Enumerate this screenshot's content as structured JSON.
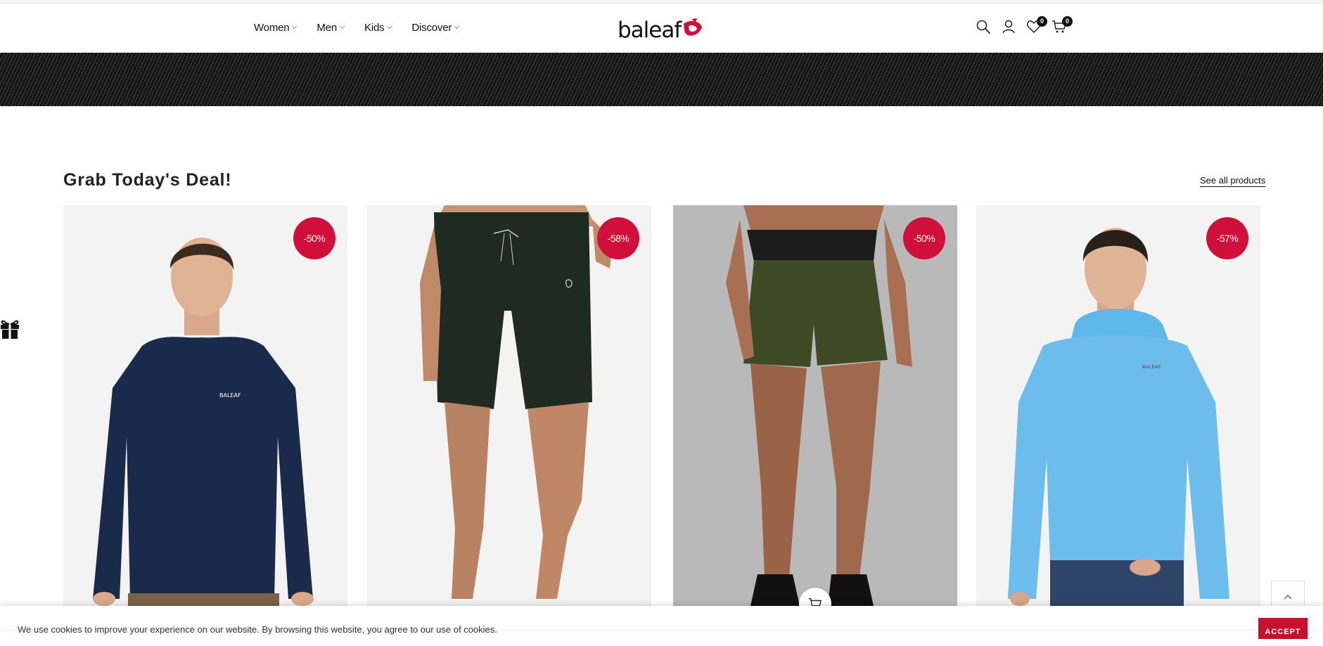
{
  "header": {
    "nav": [
      {
        "label": "Women"
      },
      {
        "label": "Men"
      },
      {
        "label": "Kids"
      },
      {
        "label": "Discover"
      }
    ],
    "logo_text": "baleaf",
    "icons": [
      "search-icon",
      "account-icon",
      "wishlist-icon",
      "cart-icon"
    ],
    "wishlist_count": "0",
    "cart_count": "0"
  },
  "section": {
    "title": "Grab Today's Deal!",
    "see_all_label": "See all products"
  },
  "products": [
    {
      "discount": "-50%",
      "description": "Men's navy long sleeve shirt"
    },
    {
      "discount": "-58%",
      "description": "Women's dark green bermuda shorts"
    },
    {
      "discount": "-50%",
      "description": "Women's olive running shorts"
    },
    {
      "discount": "-57%",
      "description": "Men's light blue hooded long sleeve shirt"
    }
  ],
  "cookie": {
    "text": "We use cookies to improve your experience on our website. By browsing this website, you agree to our use of cookies.",
    "accept_label": "ACCEPT"
  },
  "colors": {
    "accent": "#d0103a",
    "accept_button": "#c8102e"
  }
}
